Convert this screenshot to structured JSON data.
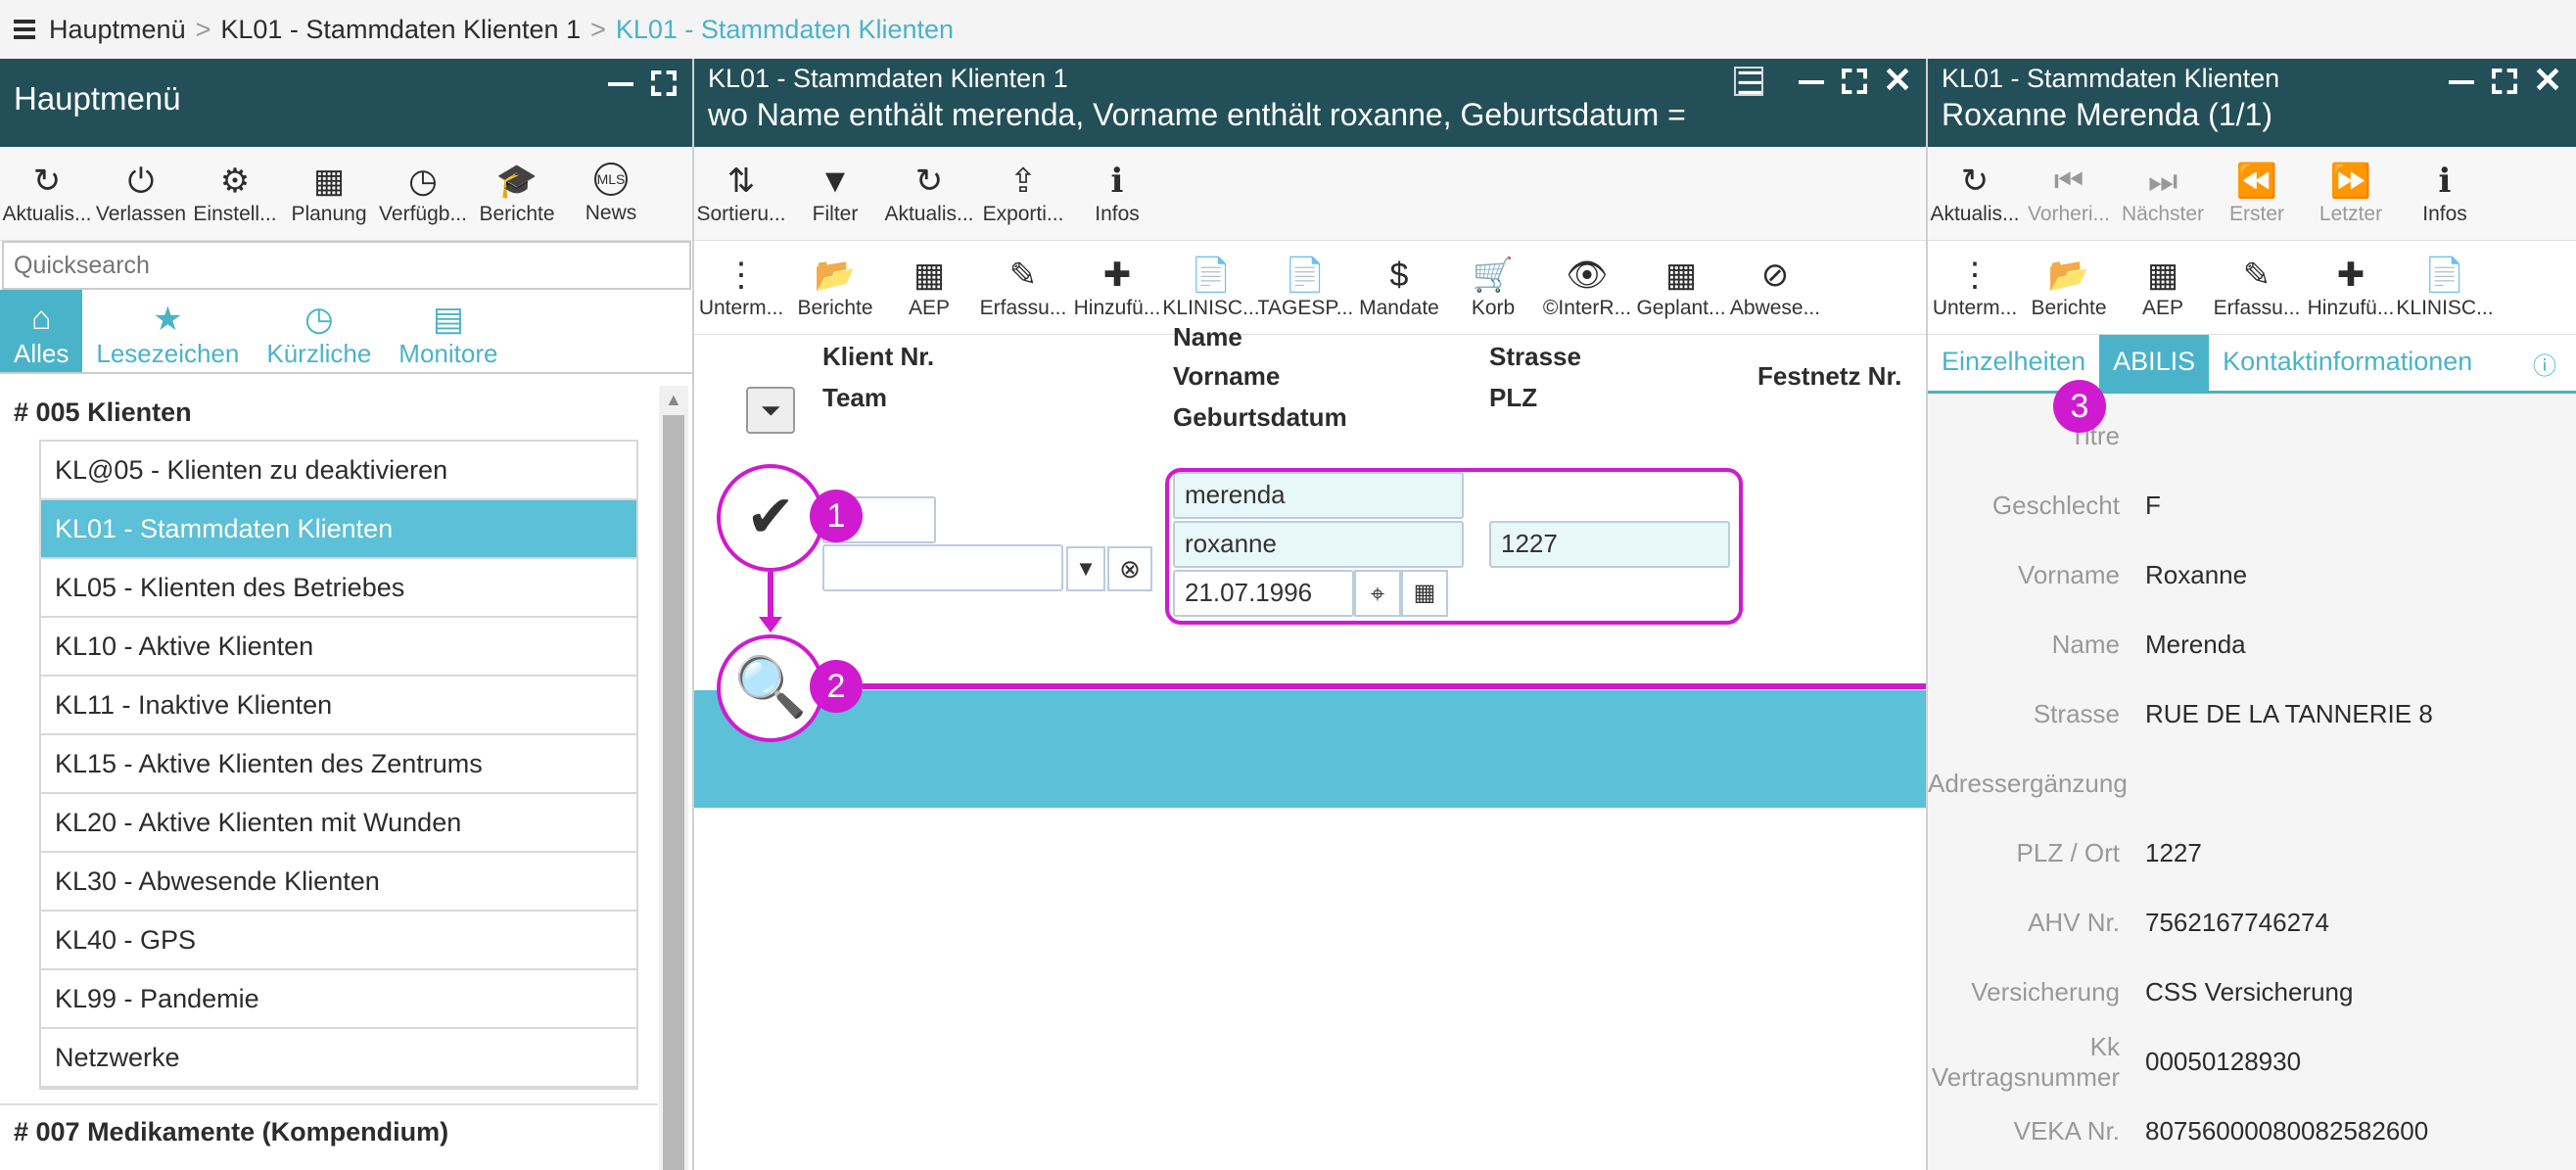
{
  "breadcrumb": [
    "Hauptmenü",
    "KL01 - Stammdaten Klienten 1",
    "KL01 - Stammdaten Klienten"
  ],
  "left": {
    "title": "Hauptmenü",
    "toolbar": [
      {
        "label": "Aktualis...",
        "icon": "↻"
      },
      {
        "label": "Verlassen",
        "icon": "⏻"
      },
      {
        "label": "Einstell...",
        "icon": "⚙"
      },
      {
        "label": "Planung",
        "icon": "▦"
      },
      {
        "label": "Verfügb...",
        "icon": "◷"
      },
      {
        "label": "Berichte",
        "icon": "🎓"
      },
      {
        "label": "News",
        "icon": "MLS"
      }
    ],
    "quicksearch_placeholder": "Quicksearch",
    "tabs": [
      {
        "label": "Alles",
        "icon": "⌂"
      },
      {
        "label": "Lesezeichen",
        "icon": "★"
      },
      {
        "label": "Kürzliche",
        "icon": "◷"
      },
      {
        "label": "Monitore",
        "icon": "▤"
      }
    ],
    "group1": "# 005 Klienten",
    "items": [
      "KL@05 - Klienten zu deaktivieren",
      "KL01 - Stammdaten Klienten",
      "KL05 - Klienten des Betriebes",
      "KL10 - Aktive Klienten",
      "KL11 - Inaktive Klienten",
      "KL15 - Aktive Klienten des Zentrums",
      "KL20 - Aktive Klienten mit Wunden",
      "KL30 - Abwesende Klienten",
      "KL40 - GPS",
      "KL99 - Pandemie",
      "Netzwerke"
    ],
    "group2": "# 007 Medikamente (Kompendium)"
  },
  "middle": {
    "subtitle": "KL01 - Stammdaten Klienten 1",
    "title": "wo Name enthält merenda, Vorname enthält roxanne, Geburtsdatum =",
    "toolbar": [
      {
        "label": "Sortieru...",
        "icon": "⇅"
      },
      {
        "label": "Filter",
        "icon": "▼"
      },
      {
        "label": "Aktualis...",
        "icon": "↻"
      },
      {
        "label": "Exporti...",
        "icon": "⇪"
      },
      {
        "label": "Infos",
        "icon": "ℹ"
      }
    ],
    "toolbar2": [
      {
        "label": "Unterm...",
        "icon": "⋮"
      },
      {
        "label": "Berichte",
        "icon": "📂"
      },
      {
        "label": "AEP",
        "icon": "▦"
      },
      {
        "label": "Erfassu...",
        "icon": "✎"
      },
      {
        "label": "Hinzufü...",
        "icon": "✚"
      },
      {
        "label": "KLINISC...",
        "icon": "📄"
      },
      {
        "label": "TAGESP...",
        "icon": "📄"
      },
      {
        "label": "Mandate",
        "icon": "$"
      },
      {
        "label": "Korb",
        "icon": "🛒"
      },
      {
        "label": "©InterR...",
        "icon": "👁"
      },
      {
        "label": "Geplant...",
        "icon": "▦"
      },
      {
        "label": "Abwese...",
        "icon": "⊘"
      }
    ],
    "columns": {
      "klient_nr": "Klient Nr.",
      "team": "Team",
      "name": "Name",
      "vorname": "Vorname",
      "geburtsdatum": "Geburtsdatum",
      "strasse": "Strasse",
      "plz": "PLZ",
      "festnetz": "Festnetz Nr."
    },
    "filter": {
      "name": "merenda",
      "vorname": "roxanne",
      "geburtsdatum": "21.07.1996",
      "plz": "1227"
    },
    "badges": [
      "1",
      "2"
    ]
  },
  "right": {
    "subtitle": "KL01 - Stammdaten Klienten",
    "title": "Roxanne Merenda (1/1)",
    "toolbar": [
      {
        "label": "Aktualis...",
        "icon": "↻",
        "disabled": false
      },
      {
        "label": "Vorheri...",
        "icon": "⏮",
        "disabled": true
      },
      {
        "label": "Nächster",
        "icon": "⏭",
        "disabled": true
      },
      {
        "label": "Erster",
        "icon": "⏪",
        "disabled": true
      },
      {
        "label": "Letzter",
        "icon": "⏩",
        "disabled": true
      },
      {
        "label": "Infos",
        "icon": "ℹ",
        "disabled": false
      }
    ],
    "toolbar2": [
      {
        "label": "Unterm...",
        "icon": "⋮"
      },
      {
        "label": "Berichte",
        "icon": "📂"
      },
      {
        "label": "AEP",
        "icon": "▦"
      },
      {
        "label": "Erfassu...",
        "icon": "✎"
      },
      {
        "label": "Hinzufü...",
        "icon": "✚"
      },
      {
        "label": "KLINISC...",
        "icon": "📄"
      }
    ],
    "tabs": [
      "Einzelheiten",
      "ABILIS",
      "Kontaktinformationen"
    ],
    "badge": "3",
    "fields": [
      {
        "label": "Titre",
        "value": ""
      },
      {
        "label": "Geschlecht",
        "value": "F"
      },
      {
        "label": "Vorname",
        "value": "Roxanne"
      },
      {
        "label": "Name",
        "value": "Merenda"
      },
      {
        "label": "Strasse",
        "value": "RUE DE LA TANNERIE 8"
      },
      {
        "label": "Adressergänzung",
        "value": ""
      },
      {
        "label": "PLZ / Ort",
        "value": "1227"
      },
      {
        "label": "AHV Nr.",
        "value": "7562167746274"
      },
      {
        "label": "Versicherung",
        "value": "CSS Versicherung"
      },
      {
        "label": "Kk Vertragsnummer",
        "value": "00050128930"
      },
      {
        "label": "VEKA Nr.",
        "value": "80756000080082582600"
      }
    ]
  }
}
